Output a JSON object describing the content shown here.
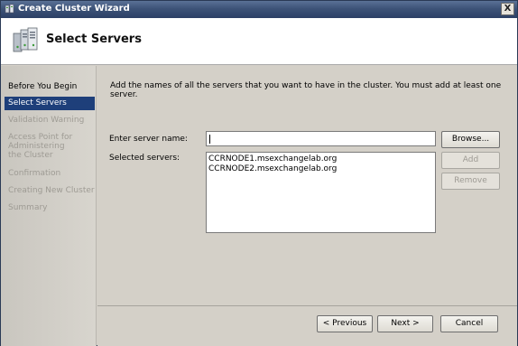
{
  "window": {
    "title": "Create Cluster Wizard",
    "close_glyph": "X"
  },
  "header": {
    "title": "Select Servers",
    "icon": "servers-icon"
  },
  "sidebar": {
    "steps": [
      {
        "label": "Before You Begin",
        "state": "completed"
      },
      {
        "label": "Select Servers",
        "state": "selected"
      },
      {
        "label": "Validation Warning",
        "state": "disabled"
      },
      {
        "label": "Access Point for Administering the Cluster",
        "state": "disabled"
      },
      {
        "label": "Confirmation",
        "state": "disabled"
      },
      {
        "label": "Creating New Cluster",
        "state": "disabled"
      },
      {
        "label": "Summary",
        "state": "disabled"
      }
    ]
  },
  "main": {
    "intro": "Add the names of all the servers that you want to have in the cluster. You must add at least one server.",
    "server_name_label": "Enter server name:",
    "server_name_value": "",
    "selected_servers_label": "Selected servers:",
    "selected_servers": [
      "CCRNODE1.msexchangelab.org",
      "CCRNODE2.msexchangelab.org"
    ],
    "browse_button": "Browse...",
    "add_button": "Add",
    "remove_button": "Remove"
  },
  "footer": {
    "previous_button": "< Previous",
    "next_button": "Next >",
    "cancel_button": "Cancel"
  },
  "colors": {
    "title_bar": "#3d5378",
    "selected_step": "#1e3f7a",
    "dialog_bg": "#d4d0c8"
  }
}
